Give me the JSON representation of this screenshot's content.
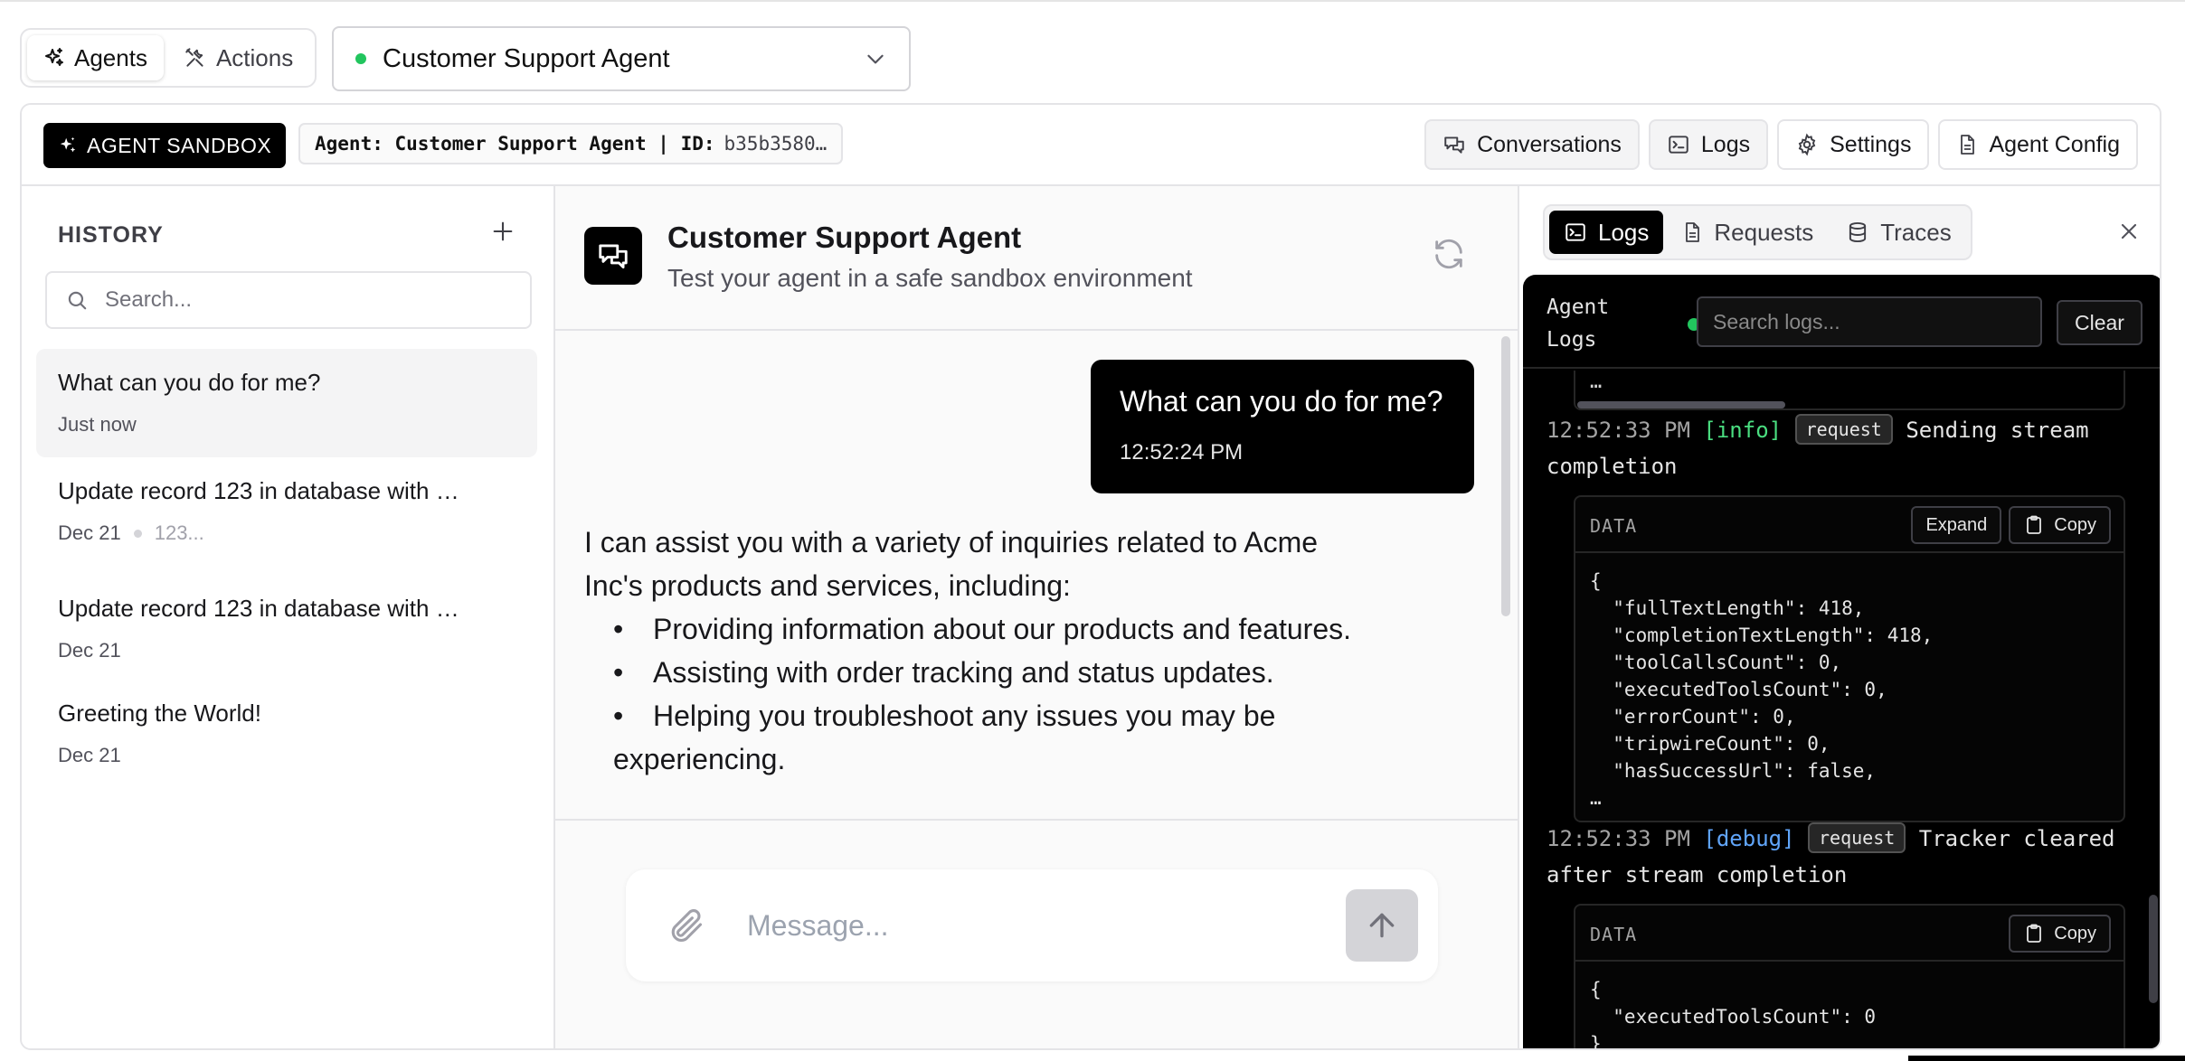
{
  "mode_switch": {
    "agents_label": "Agents",
    "actions_label": "Actions"
  },
  "agent_selector": {
    "name": "Customer Support Agent",
    "status_color": "#22c55e"
  },
  "header": {
    "badge_label": "AGENT SANDBOX",
    "agent_label": "Agent: Customer Support Agent | ID:",
    "agent_id": "b35b3580…",
    "buttons": {
      "conversations": "Conversations",
      "logs": "Logs",
      "settings": "Settings",
      "agent_config": "Agent Config"
    }
  },
  "history": {
    "title": "HISTORY",
    "search_placeholder": "Search...",
    "items": [
      {
        "title": "What can you do for me?",
        "date": "Just now"
      },
      {
        "title": "Update record 123 in database with …",
        "date": "Dec 21",
        "preview": "123..."
      },
      {
        "title": "Update record 123 in database with …",
        "date": "Dec 21"
      },
      {
        "title": "Greeting the World!",
        "date": "Dec 21"
      }
    ]
  },
  "chat": {
    "title": "Customer Support Agent",
    "subtitle": "Test your agent in a safe sandbox environment",
    "user_message": {
      "text": "What can you do for me?",
      "time": "12:52:24 PM"
    },
    "assistant_message": {
      "intro": "I can assist you with a variety of inquiries related to Acme Inc's products and services, including:",
      "bullets": [
        "Providing information about our products and features.",
        "Assisting with order tracking and status updates.",
        "Helping you troubleshoot any issues you may be experiencing."
      ]
    },
    "composer_placeholder": "Message..."
  },
  "logs_panel": {
    "tabs": {
      "logs": "Logs",
      "requests": "Requests",
      "traces": "Traces"
    },
    "terminal_title": "Agent Logs",
    "search_placeholder": "Search logs...",
    "clear_label": "Clear",
    "prev_ellipsis": "…",
    "entries": [
      {
        "time": "12:52:33 PM",
        "level": "[info]",
        "tag": "request",
        "message": "Sending stream completion",
        "data_label": "DATA",
        "expand_label": "Expand",
        "copy_label": "Copy",
        "data": "{\n  \"fullTextLength\": 418,\n  \"completionTextLength\": 418,\n  \"toolCallsCount\": 0,\n  \"executedToolsCount\": 0,\n  \"errorCount\": 0,\n  \"tripwireCount\": 0,\n  \"hasSuccessUrl\": false,\n…"
      },
      {
        "time": "12:52:33 PM",
        "level": "[debug]",
        "tag": "request",
        "message": "Tracker cleared after stream completion",
        "data_label": "DATA",
        "copy_label": "Copy",
        "data": "{\n  \"executedToolsCount\": 0\n}"
      }
    ]
  },
  "colors": {
    "accent": "#000000",
    "status_green": "#22c55e",
    "info_green": "#4ade80",
    "debug_blue": "#60a5fa"
  }
}
